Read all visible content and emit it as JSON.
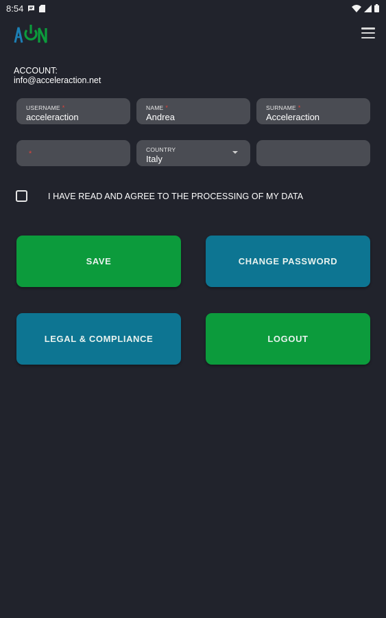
{
  "status_bar": {
    "time": "8:54"
  },
  "account": {
    "label": "ACCOUNT:",
    "email": "info@acceleraction.net"
  },
  "fields": {
    "username": {
      "label": "USERNAME",
      "required": "*",
      "value": "acceleraction"
    },
    "name": {
      "label": "NAME",
      "required": "*",
      "value": "Andrea"
    },
    "surname": {
      "label": "SURNAME",
      "required": "*",
      "value": "Acceleraction"
    },
    "unlabeled_required": {
      "required": "*",
      "value": ""
    },
    "country": {
      "label": "COUNTRY",
      "value": "Italy"
    },
    "extra": {
      "value": ""
    }
  },
  "consent": {
    "text": "I HAVE READ AND AGREE TO THE PROCESSING OF MY DATA",
    "checked": false
  },
  "buttons": {
    "save": "SAVE",
    "change_password": "CHANGE PASSWORD",
    "legal": "LEGAL & COMPLIANCE",
    "logout": "LOGOUT"
  },
  "colors": {
    "background": "#21232c",
    "field": "#4a4c53",
    "green": "#0c9b3c",
    "blue": "#0d7592",
    "required": "#e0433b"
  },
  "icons": [
    "message-icon",
    "sd-card-icon",
    "wifi-icon",
    "signal-icon",
    "battery-icon",
    "app-logo",
    "hamburger-menu-icon",
    "dropdown-arrow-icon"
  ]
}
